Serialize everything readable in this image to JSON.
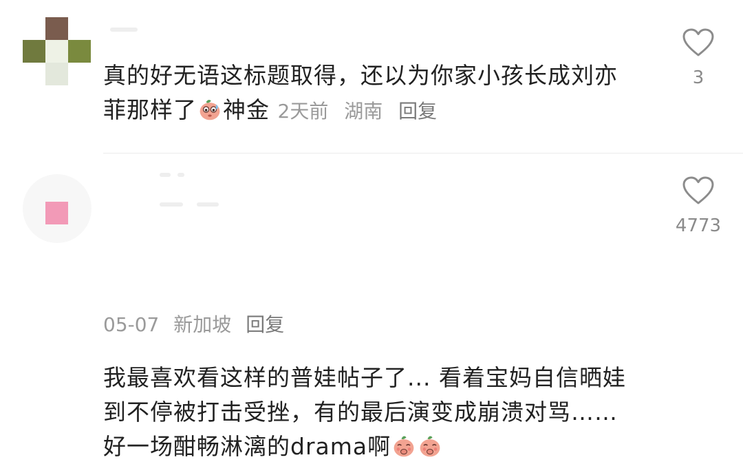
{
  "comments": [
    {
      "text": "真的好无语这标题取得，还以为你家小孩长成刘亦菲那样了",
      "trailing_text": "神金",
      "emojis": [
        "shy-sweat-emoji"
      ],
      "time": "2天前",
      "location": "湖南",
      "reply_label": "回复",
      "likes": "3",
      "avatar_colors": {
        "top": "#7a5c4e",
        "left": "#707a3e",
        "right": "#7a8a3e",
        "center": "#eef2e6",
        "bottom": "#e3e8dc"
      }
    },
    {
      "text": "我最喜欢看这样的普娃帖子了... 看着宝妈自信晒娃到不停被打击受挫，有的最后演变成崩溃对骂……好一场酣畅淋漓的drama啊",
      "emojis": [
        "giggle-emoji",
        "giggle-emoji"
      ],
      "time": "05-07",
      "location": "新加坡",
      "reply_label": "回复",
      "likes": "4773",
      "avatar_colors": {
        "main": "#f29ab7",
        "halo": "#f7f7f7"
      }
    }
  ],
  "colors": {
    "text": "#222222",
    "meta": "#9a9a9a",
    "heart_outline": "#8c8c8c",
    "divider": "#ececec",
    "emoji_skin": "#f2a391",
    "emoji_leaf": "#5aa05a"
  }
}
